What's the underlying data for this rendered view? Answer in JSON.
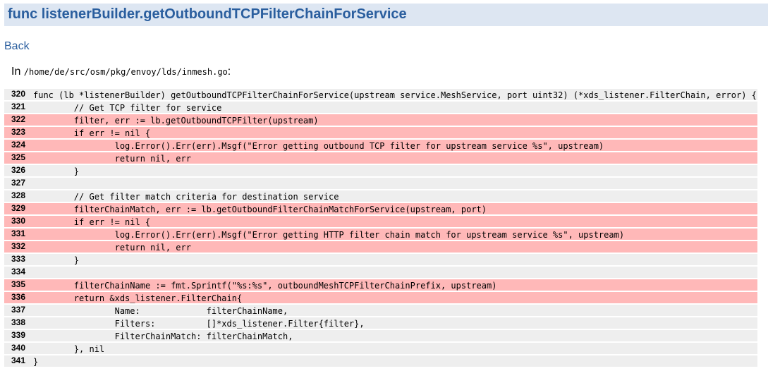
{
  "header": {
    "title": "func listenerBuilder.getOutboundTCPFilterChainForService"
  },
  "nav": {
    "back_label": "Back"
  },
  "file": {
    "prefix": "In ",
    "path": "/home/de/src/osm/pkg/envoy/lds/inmesh.go",
    "suffix": ":"
  },
  "colors": {
    "title_bg": "#dde6f2",
    "title_text": "#2a5e9e",
    "covered_row_bg": "#eeeeee",
    "uncovered_row_bg": "#ffb8b8"
  },
  "code": {
    "lines": [
      {
        "no": "320",
        "text": "func (lb *listenerBuilder) getOutboundTCPFilterChainForService(upstream service.MeshService, port uint32) (*xds_listener.FilterChain, error) {",
        "uncovered": false
      },
      {
        "no": "321",
        "text": "\t// Get TCP filter for service",
        "uncovered": false
      },
      {
        "no": "322",
        "text": "\tfilter, err := lb.getOutboundTCPFilter(upstream)",
        "uncovered": true
      },
      {
        "no": "323",
        "text": "\tif err != nil {",
        "uncovered": true
      },
      {
        "no": "324",
        "text": "\t\tlog.Error().Err(err).Msgf(\"Error getting outbound TCP filter for upstream service %s\", upstream)",
        "uncovered": true
      },
      {
        "no": "325",
        "text": "\t\treturn nil, err",
        "uncovered": true
      },
      {
        "no": "326",
        "text": "\t}",
        "uncovered": false
      },
      {
        "no": "327",
        "text": "",
        "uncovered": false
      },
      {
        "no": "328",
        "text": "\t// Get filter match criteria for destination service",
        "uncovered": false
      },
      {
        "no": "329",
        "text": "\tfilterChainMatch, err := lb.getOutboundFilterChainMatchForService(upstream, port)",
        "uncovered": true
      },
      {
        "no": "330",
        "text": "\tif err != nil {",
        "uncovered": true
      },
      {
        "no": "331",
        "text": "\t\tlog.Error().Err(err).Msgf(\"Error getting HTTP filter chain match for upstream service %s\", upstream)",
        "uncovered": true
      },
      {
        "no": "332",
        "text": "\t\treturn nil, err",
        "uncovered": true
      },
      {
        "no": "333",
        "text": "\t}",
        "uncovered": false
      },
      {
        "no": "334",
        "text": "",
        "uncovered": false
      },
      {
        "no": "335",
        "text": "\tfilterChainName := fmt.Sprintf(\"%s:%s\", outboundMeshTCPFilterChainPrefix, upstream)",
        "uncovered": true
      },
      {
        "no": "336",
        "text": "\treturn &xds_listener.FilterChain{",
        "uncovered": true
      },
      {
        "no": "337",
        "text": "\t\tName:             filterChainName,",
        "uncovered": false
      },
      {
        "no": "338",
        "text": "\t\tFilters:          []*xds_listener.Filter{filter},",
        "uncovered": false
      },
      {
        "no": "339",
        "text": "\t\tFilterChainMatch: filterChainMatch,",
        "uncovered": false
      },
      {
        "no": "340",
        "text": "\t}, nil",
        "uncovered": false
      },
      {
        "no": "341",
        "text": "}",
        "uncovered": false
      }
    ]
  }
}
